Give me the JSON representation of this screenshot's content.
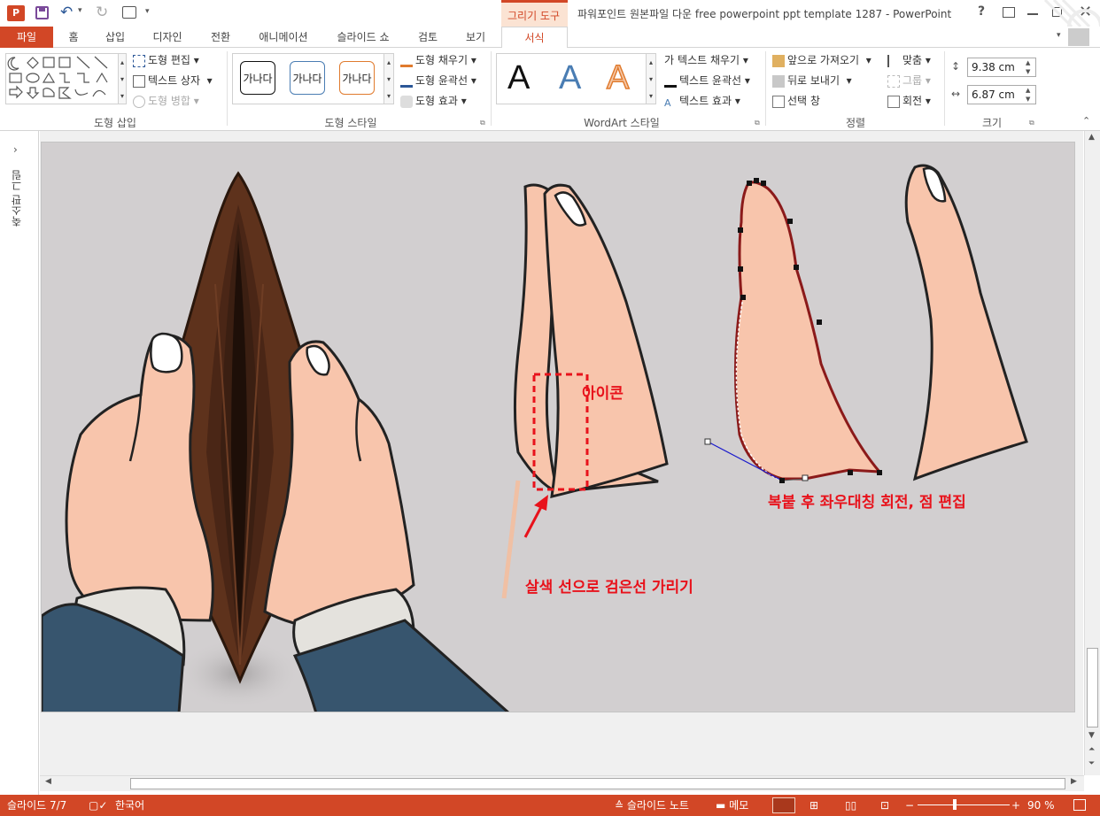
{
  "app": {
    "title": "파워포인트 원본파일 다운 free powerpoint ppt template 1287 - PowerPoint",
    "contextual_tab_group": "그리기 도구",
    "help_label": "?"
  },
  "tabs": [
    {
      "label": "파일"
    },
    {
      "label": "홈"
    },
    {
      "label": "삽입"
    },
    {
      "label": "디자인"
    },
    {
      "label": "전환"
    },
    {
      "label": "애니메이션"
    },
    {
      "label": "슬라이드 쇼"
    },
    {
      "label": "검토"
    },
    {
      "label": "보기"
    },
    {
      "label": "서식"
    }
  ],
  "ribbon": {
    "shape_insert": {
      "label": "도형 삽입",
      "edit_shape": "도형 편집",
      "text_box": "텍스트 상자",
      "merge_shapes": "도형 병합"
    },
    "shape_styles": {
      "label": "도형 스타일",
      "samples": [
        "가나다",
        "가나다",
        "가나다"
      ],
      "fill": "도형 채우기",
      "outline": "도형 윤곽선",
      "effects": "도형 효과"
    },
    "wordart": {
      "label": "WordArt 스타일",
      "samples": [
        "A",
        "A",
        "A"
      ],
      "text_fill": "텍스트 채우기",
      "text_outline": "텍스트 윤곽선",
      "text_effects": "텍스트 효과",
      "text_fill_icon": "가"
    },
    "arrange": {
      "label": "정렬",
      "bring_forward": "앞으로 가져오기",
      "send_backward": "뒤로 보내기",
      "selection_pane": "선택 창",
      "align": "맞춤",
      "group": "그룹",
      "rotate": "회전"
    },
    "size": {
      "label": "크기",
      "height": "9.38 cm",
      "width": "6.87 cm"
    }
  },
  "left_panel": {
    "label": "축소판 그림"
  },
  "slide": {
    "annotations": {
      "icon_label": "아이콘",
      "cover_line_label": "살색 선으로 검은선 가리기",
      "copy_flip_label": "복붙 후 좌우대칭 회전, 점 편집"
    },
    "colors": {
      "background": "#d2cfd0",
      "skin": "#f8c5ac",
      "wallet_dark": "#3b2314",
      "wallet_mid": "#6b3a22",
      "sleeve": "#37556e",
      "cuff": "#e4e2dd",
      "annotation_red": "#e8121b",
      "edit_path": "#8b1a1a"
    }
  },
  "status": {
    "slide": "슬라이드 7/7",
    "language": "한국어",
    "notes": "슬라이드 노트",
    "comments": "메모",
    "zoom": "90 %"
  },
  "accent": "#d24726"
}
